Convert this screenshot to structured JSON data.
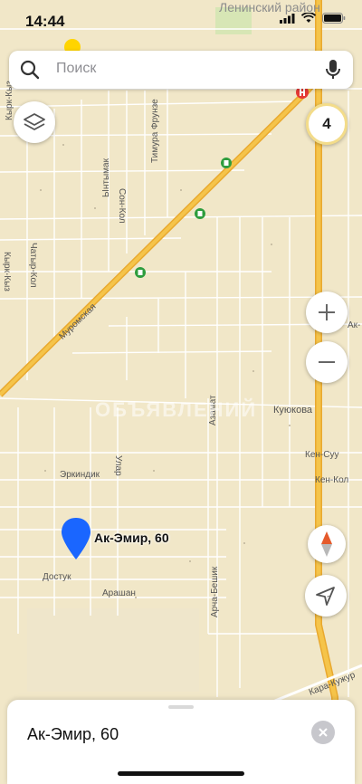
{
  "status_bar": {
    "time": "14:44",
    "district": "Ленинский район"
  },
  "search": {
    "placeholder": "Поиск"
  },
  "traffic": {
    "level": "4"
  },
  "map_labels": {
    "muromskaya": "Муромская",
    "timura_frunze": "Тимура Фрунзе",
    "son_kol": "Сон-Кол",
    "yntymak": "Ынтымак",
    "chatyr_kol": "Чатыр-Кол",
    "kyrk_kyz_top": "Кырк-Кыз",
    "kyrk_kyz": "Кырк-Кыз",
    "azamat": "Азамат",
    "kuyukova": "Куюкова",
    "erkindik": "Эркиндик",
    "ular": "Улар",
    "ken_suu": "Кен-Суу",
    "ken_kol": "Кен-Кол",
    "dostuk": "Достук",
    "arashan": "Арашан",
    "archa_beshik": "Арча-Бешик",
    "kara_kuzhur": "Кара-Кужур",
    "ak_edge": "Ак-",
    "edge_k": "к"
  },
  "watermark": "ОБЪЯВЛЕНИЙ",
  "pin": {
    "label": "Ак-Эмир, 60"
  },
  "sheet": {
    "title": "Ак-Эмир, 60"
  },
  "colors": {
    "map_bg": "#f1e7c8",
    "major_road": "#f2b33a",
    "minor_road": "#ffffff",
    "pin": "#1a66ff"
  },
  "icons": [
    "search-icon",
    "mic-icon",
    "layers-icon",
    "zoom-in-icon",
    "zoom-out-icon",
    "compass-icon",
    "locate-icon",
    "close-icon",
    "fuel-icon",
    "hospital-icon"
  ]
}
